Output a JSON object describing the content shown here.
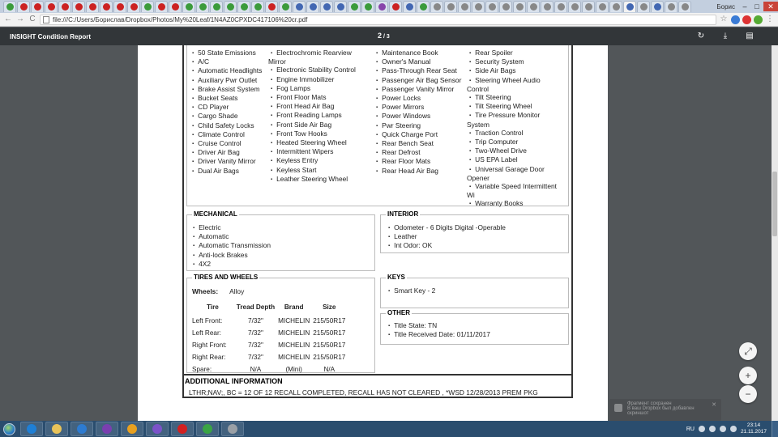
{
  "browser": {
    "tab_icon_colors": [
      "#3b9b3b",
      "#cc2222",
      "#cc2222",
      "#cc2222",
      "#cc2222",
      "#cc2222",
      "#cc2222",
      "#cc2222",
      "#cc2222",
      "#cc2222",
      "#3b9b3b",
      "#cc2222",
      "#cc2222",
      "#3b9b3b",
      "#3b9b3b",
      "#3b9b3b",
      "#3b9b3b",
      "#3b9b3b",
      "#3b9b3b",
      "#cc2222",
      "#3b9b3b",
      "#4267b2",
      "#4267b2",
      "#4267b2",
      "#4267b2",
      "#3b9b3b",
      "#3b9b3b",
      "#8844aa",
      "#cc2222",
      "#4267b2",
      "#3b9b3b",
      "#888888",
      "#888888",
      "#888888",
      "#888888",
      "#888888",
      "#888888",
      "#888888",
      "#888888",
      "#888888",
      "#888888",
      "#888888",
      "#888888",
      "#888888",
      "#888888",
      "#4267b2",
      "#888888",
      "#4267b2",
      "#888888",
      "#888888"
    ],
    "user_label": "Борис",
    "window_min": "–",
    "window_max": "□",
    "window_close": "✕",
    "address": "file:///C:/Users/Борислав/Dropbox/Photos/My%20Leaf/1N4AZ0CPXDC417106%20cr.pdf",
    "back_icon": "←",
    "forward_icon": "→",
    "reload_icon": "C",
    "star_icon": "☆"
  },
  "pdf_toolbar": {
    "title": "INSIGHT Condition Report",
    "current_page": "2",
    "page_sep": " / ",
    "total_pages": "3",
    "rotate_icon": "↻",
    "download_icon": "⤓",
    "print_icon": "▤"
  },
  "features": {
    "col1": [
      "50 State Emissions",
      "A/C",
      "Automatic Headlights",
      "Auxiliary Pwr Outlet",
      "Brake Assist System",
      "Bucket Seats",
      "CD Player",
      "Cargo Shade",
      "Child Safety Locks",
      "Climate Control",
      "Cruise Control",
      "Driver Air Bag",
      "Driver Vanity Mirror",
      "Dual Air Bags"
    ],
    "col2": [
      "Electrochromic Rearview Mirror",
      "Electronic Stability Control",
      "Engine Immobilizer",
      "Fog Lamps",
      "Front Floor Mats",
      "Front Head Air Bag",
      "Front Reading Lamps",
      "Front Side Air Bag",
      "Front Tow Hooks",
      "Heated Steering Wheel",
      "Intermittent Wipers",
      "Keyless Entry",
      "Keyless Start",
      "Leather Steering Wheel"
    ],
    "col3": [
      "Maintenance Book",
      "Owner's Manual",
      "Pass-Through Rear Seat",
      "Passenger Air Bag Sensor",
      "Passenger Vanity Mirror",
      "Power Locks",
      "Power Mirrors",
      "Power Windows",
      "Pwr Steering",
      "Quick Charge Port",
      "Rear Bench Seat",
      "Rear Defrost",
      "Rear Floor Mats",
      "Rear Head Air Bag"
    ],
    "col4": [
      "Rear Spoiler",
      "Security System",
      "Side Air Bags",
      "Steering Wheel Audio Control",
      "Tilt Steering",
      "Tilt Steering Wheel",
      "Tire Pressure Monitor System",
      "Traction Control",
      "Trip Computer",
      "Two-Wheel Drive",
      "US EPA Label",
      "Universal Garage Door Opener",
      "Variable Speed Intermittent Wi",
      "Warranty Books"
    ]
  },
  "mechanical": {
    "title": "MECHANICAL",
    "items": [
      "Electric",
      "Automatic",
      "Automatic Transmission",
      "Anti-lock Brakes",
      "4X2"
    ]
  },
  "interior": {
    "title": "INTERIOR",
    "items": [
      "Odometer - 6 Digits Digital -Operable",
      "Leather",
      "Int Odor: OK"
    ]
  },
  "tires": {
    "title": "TIRES AND WHEELS",
    "wheels_label": "Wheels:",
    "wheels_value": "Alloy",
    "headers": [
      "Tire",
      "Tread Depth",
      "Brand",
      "Size"
    ],
    "rows": [
      [
        "Left Front:",
        "7/32\"",
        "MICHELIN",
        "215/50R17"
      ],
      [
        "Left Rear:",
        "7/32\"",
        "MICHELIN",
        "215/50R17"
      ],
      [
        "Right Front:",
        "7/32\"",
        "MICHELIN",
        "215/50R17"
      ],
      [
        "Right Rear:",
        "7/32\"",
        "MICHELIN",
        "215/50R17"
      ],
      [
        "Spare:",
        "N/A",
        "(Mini)",
        "N/A"
      ]
    ]
  },
  "keys": {
    "title": "KEYS",
    "items": [
      "Smart Key - 2"
    ]
  },
  "other": {
    "title": "OTHER",
    "items": [
      "Title State: TN",
      "Title Received Date: 01/11/2017"
    ]
  },
  "additional": {
    "title": "ADDITIONAL INFORMATION",
    "text": "LTHR;NAV;, BC = 12 OF 12 RECALL COMPLETED, RECALL HAS NOT CLEARED , *WSD 12/28/2013 PREM PKG"
  },
  "zoom": {
    "fit_icon": "⤢",
    "zoom_in_icon": "+",
    "zoom_out_icon": "−"
  },
  "toast": {
    "line1": "Фрагмент сохранен",
    "line2": "В ваш Dropbox был добавлен скриншот",
    "close_icon": "✕"
  },
  "taskbar": {
    "app_icon_colors": [
      "#1e7fd6",
      "#e8c35a",
      "#2d7bd1",
      "#7a3fb0",
      "#e8a020",
      "#7b52c9",
      "#d32020",
      "#3aa444",
      "#9aa0a6"
    ],
    "lang": "RU",
    "time": "23:14",
    "date": "21.11.2017"
  }
}
